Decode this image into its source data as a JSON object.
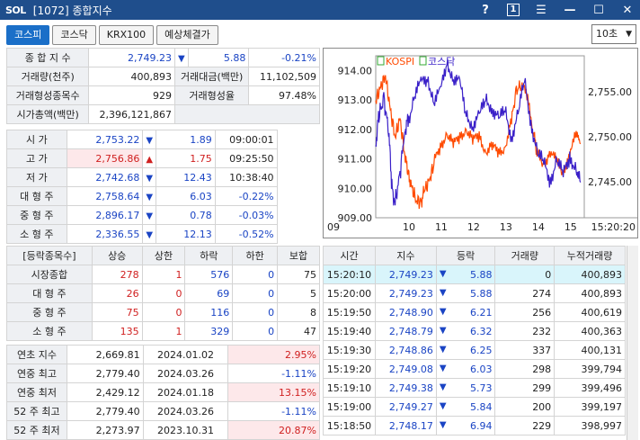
{
  "window": {
    "logo": "SOL",
    "title": "[1072] 종합지수",
    "buttons": {
      "help": "?",
      "one": "1",
      "menu": "☰",
      "minimize": "—",
      "maximize": "☐",
      "close": "✕"
    }
  },
  "tabs": [
    "코스피",
    "코스닥",
    "KRX100",
    "예상체결가"
  ],
  "interval": "10초",
  "summary": {
    "index_label": "종 합 지 수",
    "index_value": "2,749.23",
    "index_change": "5.88",
    "index_pct": "-0.21%",
    "vol_label": "거래량(천주)",
    "vol_value": "400,893",
    "amt_label": "거래대금(백만)",
    "amt_value": "11,102,509",
    "form_cnt_label": "거래형성종목수",
    "form_cnt_value": "929",
    "form_rate_label": "거래형성율",
    "form_rate_value": "97.48%",
    "cap_label": "시가총액(백만)",
    "cap_value": "2,396,121,867"
  },
  "prices": [
    {
      "label": "시 가",
      "value": "2,753.22",
      "dir": "down",
      "change": "1.89",
      "extra": "09:00:01",
      "color": "blue"
    },
    {
      "label": "고 가",
      "value": "2,756.86",
      "dir": "up",
      "change": "1.75",
      "extra": "09:25:50",
      "color": "red"
    },
    {
      "label": "저 가",
      "value": "2,742.68",
      "dir": "down",
      "change": "12.43",
      "extra": "10:38:40",
      "color": "blue"
    },
    {
      "label": "대 형 주",
      "value": "2,758.64",
      "dir": "down",
      "change": "6.03",
      "extra": "-0.22%",
      "color": "blue"
    },
    {
      "label": "중 형 주",
      "value": "2,896.17",
      "dir": "down",
      "change": "0.78",
      "extra": "-0.03%",
      "color": "blue"
    },
    {
      "label": "소 형 주",
      "value": "2,336.55",
      "dir": "down",
      "change": "12.13",
      "extra": "-0.52%",
      "color": "blue"
    }
  ],
  "breadth": {
    "headers": [
      "[등락종목수]",
      "상승",
      "상한",
      "하락",
      "하한",
      "보합"
    ],
    "rows": [
      {
        "label": "시장종합",
        "up": "278",
        "limit_up": "1",
        "down": "576",
        "limit_down": "0",
        "flat": "75"
      },
      {
        "label": "대 형 주",
        "up": "26",
        "limit_up": "0",
        "down": "69",
        "limit_down": "0",
        "flat": "5"
      },
      {
        "label": "중 형 주",
        "up": "75",
        "limit_up": "0",
        "down": "116",
        "limit_down": "0",
        "flat": "8"
      },
      {
        "label": "소 형 주",
        "up": "135",
        "limit_up": "1",
        "down": "329",
        "limit_down": "0",
        "flat": "47"
      }
    ]
  },
  "history": [
    {
      "label": "연초 지수",
      "value": "2,669.81",
      "date": "2024.01.02",
      "pct": "2.95%"
    },
    {
      "label": "연중 최고",
      "value": "2,779.40",
      "date": "2024.03.26",
      "pct": "-1.11%"
    },
    {
      "label": "연중 최저",
      "value": "2,429.12",
      "date": "2024.01.18",
      "pct": "13.15%"
    },
    {
      "label": "52 주 최고",
      "value": "2,779.40",
      "date": "2024.03.26",
      "pct": "-1.11%"
    },
    {
      "label": "52 주 최저",
      "value": "2,273.97",
      "date": "2023.10.31",
      "pct": "20.87%"
    }
  ],
  "ticks": {
    "headers": [
      "시간",
      "지수",
      "등락",
      "거래량",
      "누적거래량"
    ],
    "rows": [
      {
        "time": "15:20:10",
        "index": "2,749.23",
        "change": "5.88",
        "vol": "0",
        "cum": "400,893"
      },
      {
        "time": "15:20:00",
        "index": "2,749.23",
        "change": "5.88",
        "vol": "274",
        "cum": "400,893"
      },
      {
        "time": "15:19:50",
        "index": "2,748.90",
        "change": "6.21",
        "vol": "256",
        "cum": "400,619"
      },
      {
        "time": "15:19:40",
        "index": "2,748.79",
        "change": "6.32",
        "vol": "232",
        "cum": "400,363"
      },
      {
        "time": "15:19:30",
        "index": "2,748.86",
        "change": "6.25",
        "vol": "337",
        "cum": "400,131"
      },
      {
        "time": "15:19:20",
        "index": "2,749.08",
        "change": "6.03",
        "vol": "298",
        "cum": "399,794"
      },
      {
        "time": "15:19:10",
        "index": "2,749.38",
        "change": "5.73",
        "vol": "299",
        "cum": "399,496"
      },
      {
        "time": "15:19:00",
        "index": "2,749.27",
        "change": "5.84",
        "vol": "200",
        "cum": "399,197"
      },
      {
        "time": "15:18:50",
        "index": "2,748.17",
        "change": "6.94",
        "vol": "229",
        "cum": "398,997"
      }
    ]
  },
  "chart_data": {
    "type": "line",
    "legend": [
      "KOSPI",
      "코스닥"
    ],
    "colors": {
      "kospi": "#ff4a00",
      "kosdaq": "#3a20c8"
    },
    "x_ticks": [
      "09",
      "10",
      "11",
      "12",
      "13",
      "14",
      "15"
    ],
    "x_end_label": "15:20:20",
    "left_ticks": [
      "914.00",
      "913.00",
      "912.00",
      "911.00",
      "910.00",
      "909.00"
    ],
    "right_ticks": [
      "2,755.00",
      "2,750.00",
      "2,745.00"
    ],
    "left_ylim": [
      909,
      914.5
    ],
    "right_ylim": [
      2741,
      2759
    ],
    "series": [
      {
        "name": "KOSPI",
        "axis": "right",
        "x": [
          9.0,
          9.15,
          9.3,
          9.45,
          9.6,
          9.75,
          9.9,
          10.0,
          10.1,
          10.25,
          10.4,
          10.5,
          10.65,
          10.8,
          11.0,
          11.2,
          11.4,
          11.6,
          11.8,
          12.0,
          12.2,
          12.4,
          12.6,
          12.8,
          13.0,
          13.2,
          13.35,
          13.5,
          13.7,
          13.9,
          14.0,
          14.2,
          14.4,
          14.6,
          14.8,
          15.0,
          15.2,
          15.33
        ],
        "y": [
          2754,
          2755.5,
          2756.8,
          2753,
          2750,
          2752,
          2748,
          2746,
          2744.5,
          2743,
          2742.7,
          2744,
          2745,
          2747,
          2749,
          2750.5,
          2749,
          2750,
          2751,
          2749.5,
          2750,
          2748.5,
          2749,
          2748,
          2749,
          2752,
          2755,
          2756,
          2754,
          2750,
          2748,
          2747,
          2748.5,
          2747,
          2746,
          2748.5,
          2750,
          2749.2
        ]
      },
      {
        "name": "코스닥",
        "axis": "left",
        "x": [
          9.0,
          9.1,
          9.25,
          9.4,
          9.5,
          9.6,
          9.75,
          9.9,
          10.0,
          10.2,
          10.4,
          10.6,
          10.8,
          11.0,
          11.2,
          11.4,
          11.6,
          11.8,
          12.0,
          12.2,
          12.4,
          12.6,
          12.8,
          13.0,
          13.2,
          13.4,
          13.6,
          13.8,
          14.0,
          14.2,
          14.4,
          14.6,
          14.8,
          15.0,
          15.2,
          15.33
        ],
        "y": [
          911.5,
          912.5,
          913,
          912,
          910,
          909.5,
          910.5,
          912,
          912.3,
          913.2,
          913.5,
          913.8,
          913,
          913.2,
          914.3,
          913.8,
          913.5,
          912.5,
          912.2,
          912.4,
          913,
          912.8,
          912.3,
          912.6,
          911.8,
          912.5,
          913.6,
          912.3,
          911.2,
          910.8,
          910.3,
          911,
          910.4,
          911.1,
          910.7,
          910.2
        ]
      }
    ]
  }
}
